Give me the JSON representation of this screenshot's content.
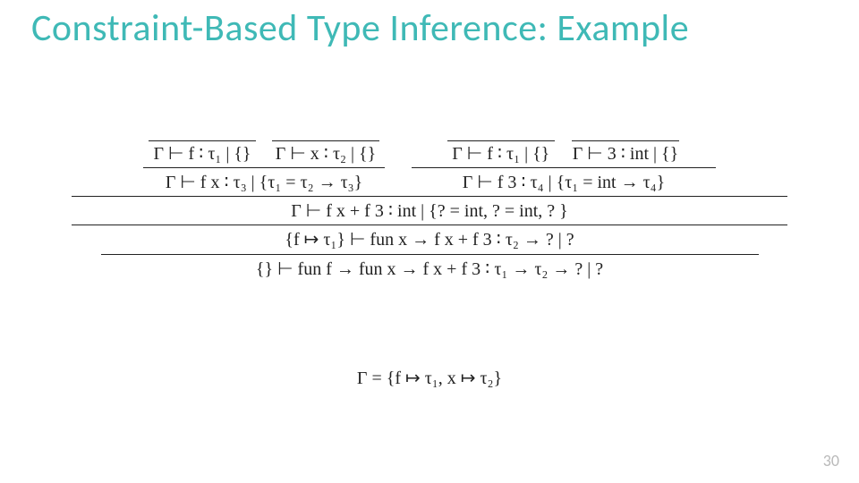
{
  "title": "Constraint-Based Type Inference: Example",
  "page_number": "30",
  "gamma_def": "Γ = {f ↦ τ₁, x ↦ τ₂}",
  "tree": {
    "top": {
      "leftpair": {
        "ax1": "Γ ⊢ f ∶ τ₁ | {}",
        "ax2": "Γ ⊢ x ∶ τ₂ | {}",
        "concl": "Γ ⊢ f x ∶ τ₃ | {τ₁ = τ₂ → τ₃}"
      },
      "rightpair": {
        "ax1": "Γ ⊢ f ∶ τ₁ | {}",
        "ax2": "Γ ⊢ 3 ∶ int | {}",
        "concl": "Γ ⊢ f 3 ∶ τ₄ | {τ₁ = int → τ₄}"
      }
    },
    "level3": "Γ ⊢ f x + f 3 ∶ int | {? = int, ? = int, ? }",
    "level2": "{f ↦ τ₁} ⊢ fun x → f x + f 3 ∶ τ₂ → ? | ?",
    "level1": "{} ⊢ fun f → fun x → f x + f 3 ∶ τ₁ → τ₂ → ? | ?"
  }
}
